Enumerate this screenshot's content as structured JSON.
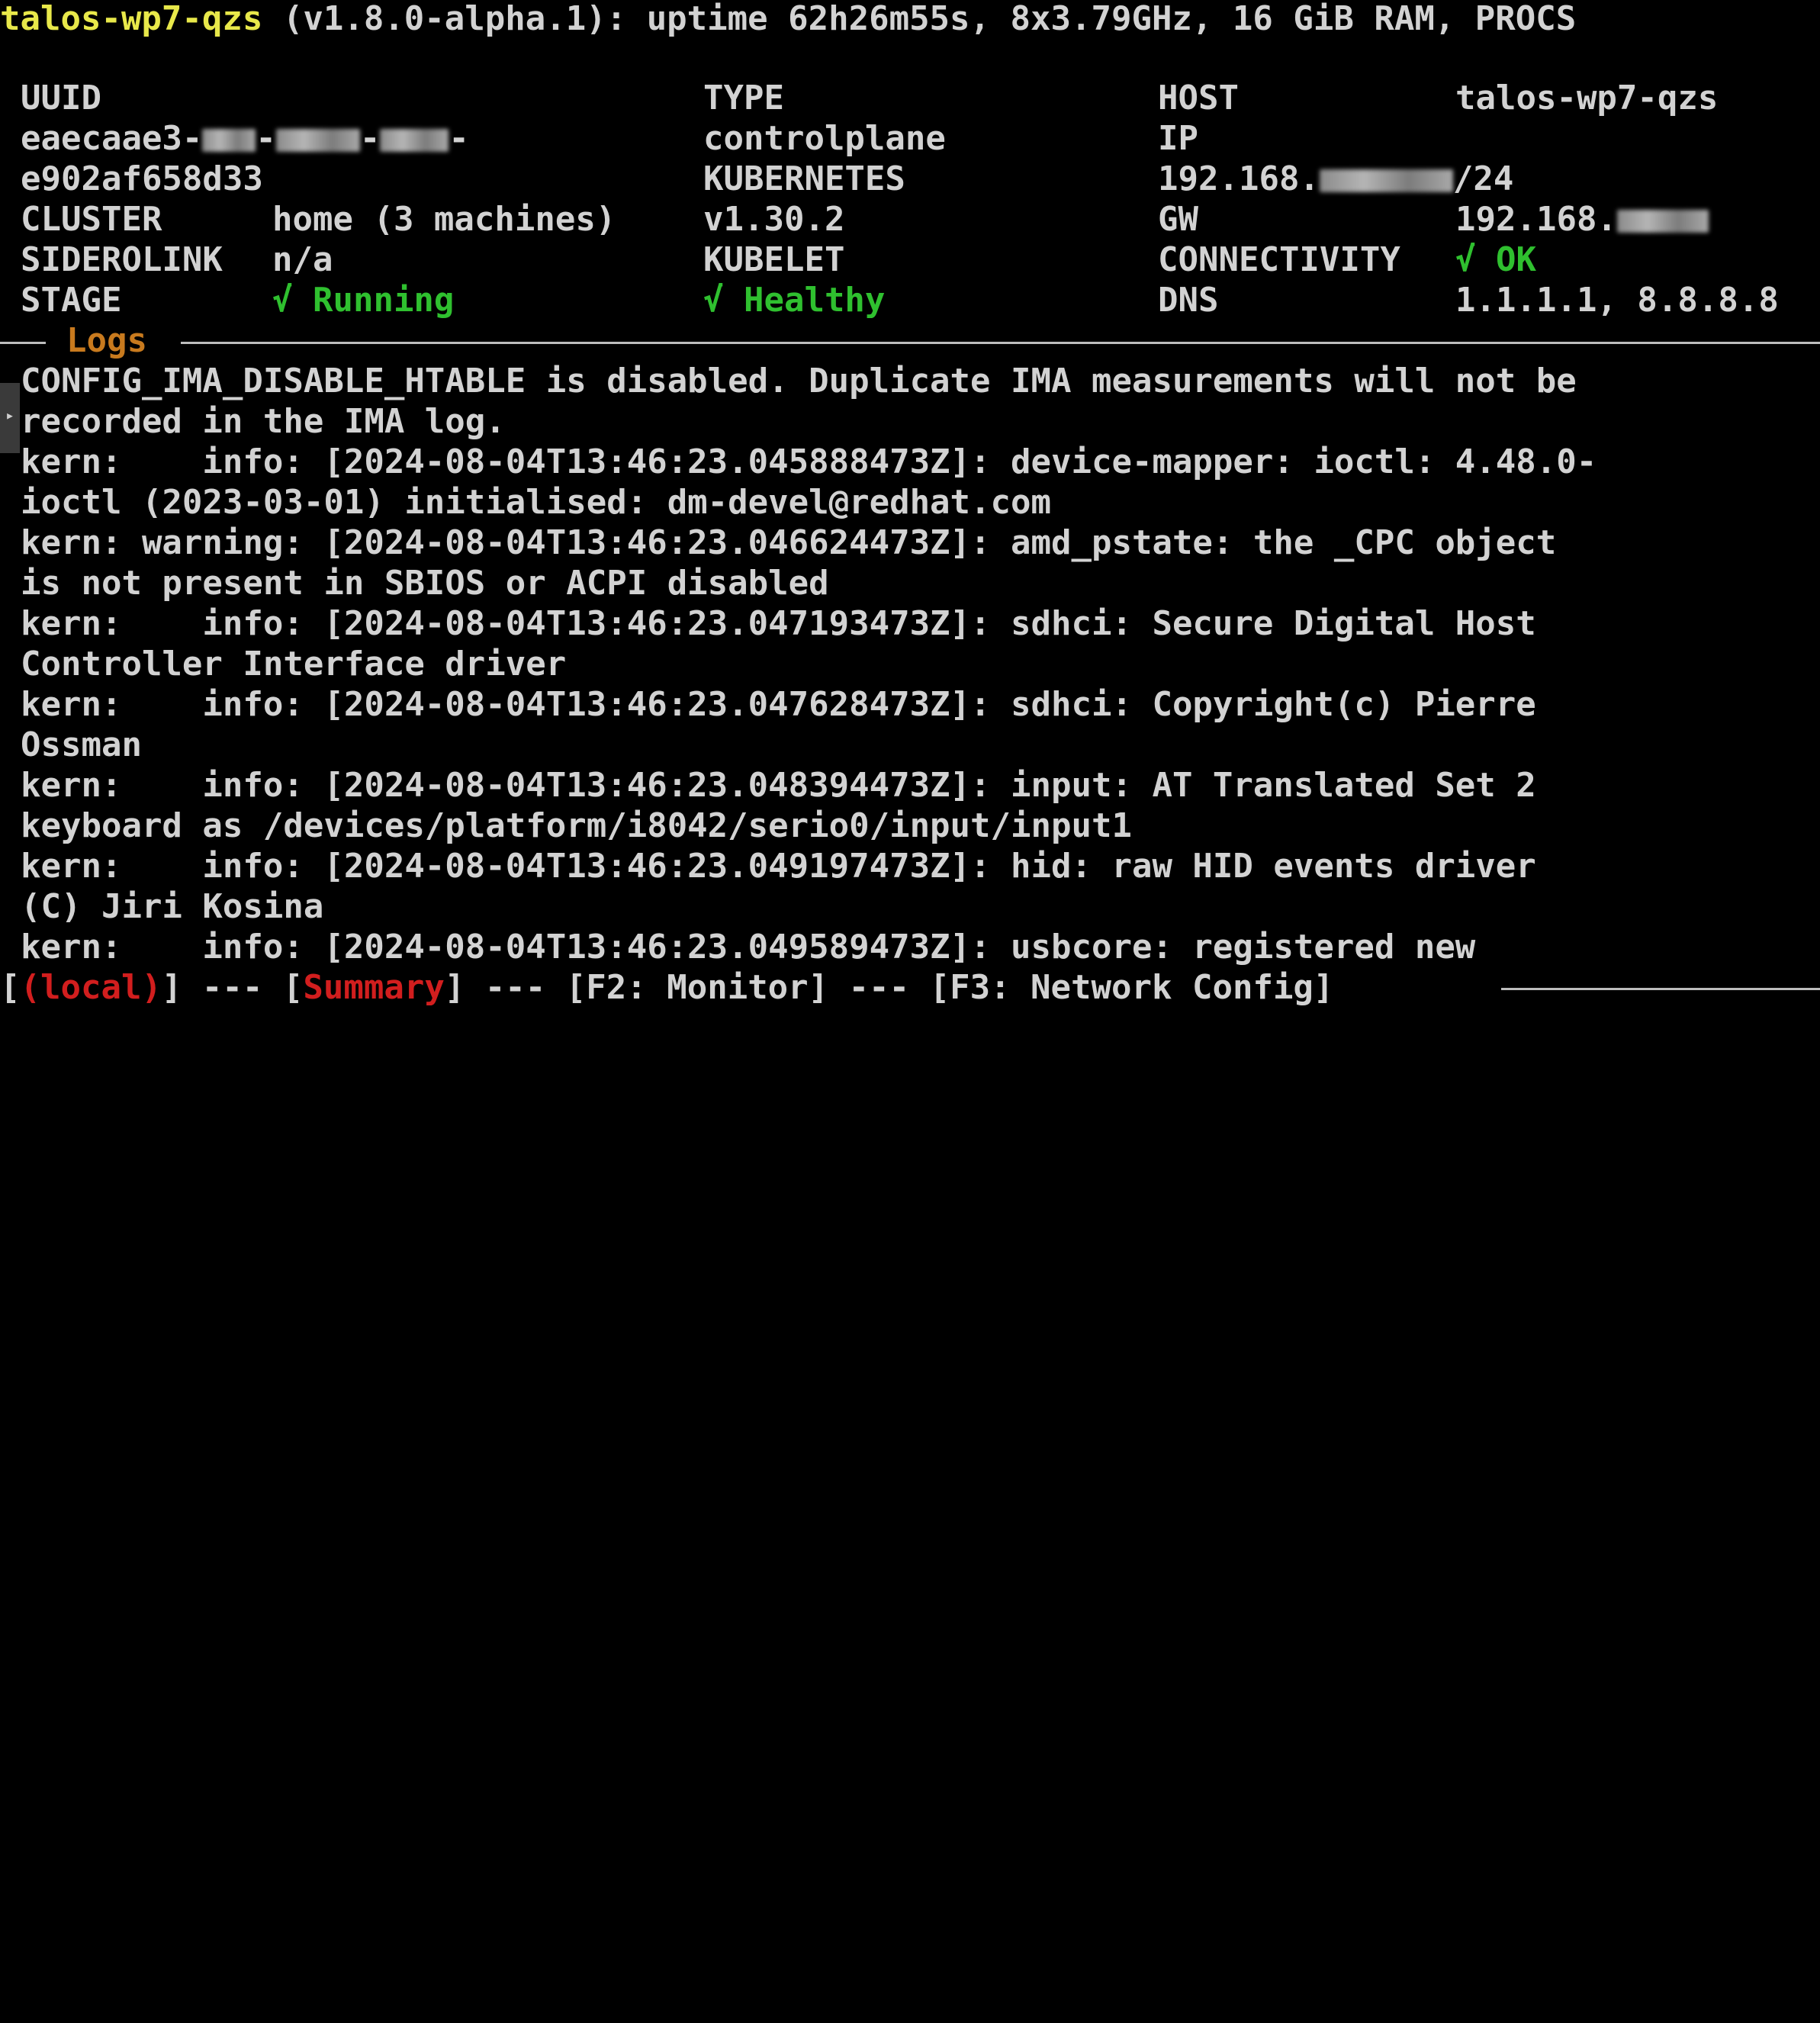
{
  "header": {
    "hostname": "talos-wp7-qzs",
    "rest": " (v1.8.0-alpha.1): uptime 62h26m55s, 8x3.79GHz, 16 GiB RAM, PROCS"
  },
  "summary": {
    "uuid_label": "UUID",
    "uuid_line1": "eaecaae3-",
    "uuid_sep1": "-",
    "uuid_sep2": "-",
    "uuid_tail1": "-",
    "uuid_line2": "e902af658d33",
    "cluster_label": "CLUSTER",
    "cluster_value": "home (3 machines)",
    "siderolink_label": "SIDEROLINK",
    "siderolink_value": "n/a",
    "stage_label": "STAGE",
    "stage_value": "√ Running",
    "type_label": "TYPE",
    "type_value": "controlplane",
    "kubernetes_label": "KUBERNETES",
    "kubernetes_value": "v1.30.2",
    "kubelet_label": "KUBELET",
    "kubelet_value": "√ Healthy",
    "host_label": "HOST",
    "host_value": "talos-wp7-qzs",
    "ip_label": "IP",
    "ip_prefix": "192.168.",
    "ip_suffix": "/24",
    "gw_label": "GW",
    "gw_prefix": "192.168.",
    "connectivity_label": "CONNECTIVITY",
    "connectivity_value": "√ OK",
    "dns_label": "DNS",
    "dns_value": "1.1.1.1, 8.8.8.8"
  },
  "logs": {
    "section_title": "Logs",
    "lines": [
      "CONFIG_IMA_DISABLE_HTABLE is disabled. Duplicate IMA measurements will not be",
      "recorded in the IMA log.",
      "kern:    info: [2024-08-04T13:46:23.045888473Z]: device-mapper: ioctl: 4.48.0-",
      "ioctl (2023-03-01) initialised: dm-devel@redhat.com",
      "kern: warning: [2024-08-04T13:46:23.046624473Z]: amd_pstate: the _CPC object",
      "is not present in SBIOS or ACPI disabled",
      "kern:    info: [2024-08-04T13:46:23.047193473Z]: sdhci: Secure Digital Host",
      "Controller Interface driver",
      "kern:    info: [2024-08-04T13:46:23.047628473Z]: sdhci: Copyright(c) Pierre",
      "Ossman",
      "kern:    info: [2024-08-04T13:46:23.048394473Z]: input: AT Translated Set 2",
      "keyboard as /devices/platform/i8042/serio0/input/input1",
      "kern:    info: [2024-08-04T13:46:23.049197473Z]: hid: raw HID events driver",
      "(C) Jiri Kosina",
      "kern:    info: [2024-08-04T13:46:23.049589473Z]: usbcore: registered new"
    ]
  },
  "footer": {
    "open_bracket": "[",
    "local": "(local)",
    "close_bracket": "]",
    "sep1": " --- ",
    "summary_open": "[",
    "summary": "Summary",
    "summary_close": "]",
    "sep2": " --- ",
    "f2": "[F2: Monitor]",
    "sep3": " --- ",
    "f3": "[F3: Network Config]"
  },
  "colors": {
    "background": "#000000",
    "text": "#d2d2d2",
    "hostname": "#e8e84a",
    "ok": "#2fc02f",
    "section_title": "#c87a1e",
    "active": "#d21e1e"
  }
}
